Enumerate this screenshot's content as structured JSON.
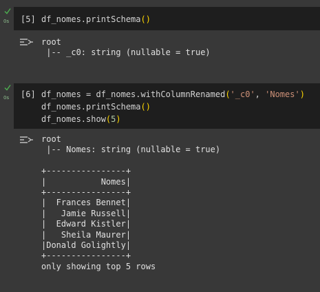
{
  "cells": [
    {
      "prompt": "[5]",
      "exec_time": "0s",
      "code_lines": [
        [
          {
            "t": "df_nomes.printSchema",
            "c": "id"
          },
          {
            "t": "()",
            "c": "paren"
          }
        ]
      ],
      "output_lines": [
        "root",
        " |-- _c0: string (nullable = true)"
      ]
    },
    {
      "prompt": "[6]",
      "exec_time": "0s",
      "code_lines": [
        [
          {
            "t": "df_nomes = df_nomes.withColumnRenamed",
            "c": "id"
          },
          {
            "t": "(",
            "c": "paren"
          },
          {
            "t": "'_c0'",
            "c": "str"
          },
          {
            "t": ", ",
            "c": "id"
          },
          {
            "t": "'Nomes'",
            "c": "str"
          },
          {
            "t": ")",
            "c": "paren"
          }
        ],
        [
          {
            "t": "df_nomes.printSchema",
            "c": "id"
          },
          {
            "t": "()",
            "c": "paren"
          }
        ],
        [
          {
            "t": "df_nomes.show",
            "c": "id"
          },
          {
            "t": "(",
            "c": "paren"
          },
          {
            "t": "5",
            "c": "num"
          },
          {
            "t": ")",
            "c": "paren"
          }
        ]
      ],
      "output_lines": [
        "root",
        " |-- Nomes: string (nullable = true)",
        "",
        "+----------------+",
        "|           Nomes|",
        "+----------------+",
        "|  Frances Bennet|",
        "|   Jamie Russell|",
        "|  Edward Kistler|",
        "|   Sheila Maurer|",
        "|Donald Golightly|",
        "+----------------+",
        "only showing top 5 rows"
      ]
    }
  ],
  "icons": {
    "status": "check-icon",
    "output_toggle": "output-icon"
  },
  "colors": {
    "background": "#383838",
    "code_background": "#1e1e1e",
    "success": "#4caf50",
    "bracket": "#ffd700",
    "string": "#ce9178",
    "number": "#b5cea8"
  }
}
